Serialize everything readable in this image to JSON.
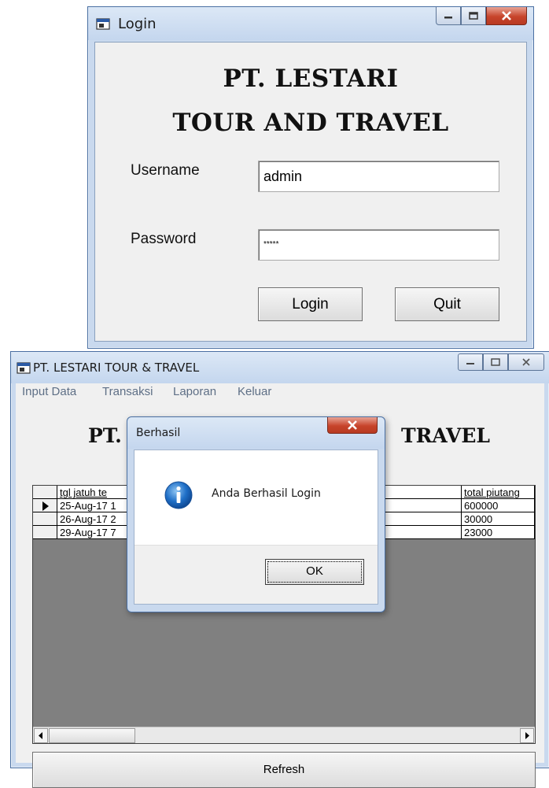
{
  "login_window": {
    "title": "Login",
    "company_line1": "PT. LESTARI",
    "company_line2": "TOUR AND TRAVEL",
    "username_label": "Username",
    "username_value": "admin",
    "password_label": "Password",
    "password_value": "*****",
    "login_button": "Login",
    "quit_button": "Quit"
  },
  "main_window": {
    "title": "PT. LESTARI TOUR & TRAVEL",
    "menu": [
      "Input Data",
      "Transaksi",
      "Laporan",
      "Keluar"
    ],
    "heading_left": "PT.",
    "heading_right": "TRAVEL",
    "grid": {
      "columns": [
        "tgl jatuh te",
        "total piutang"
      ],
      "rows": [
        {
          "col1": "25-Aug-17 1",
          "col_last": "600000"
        },
        {
          "col1": "26-Aug-17 2",
          "col_last": "30000"
        },
        {
          "col1": "29-Aug-17 7",
          "col_last": "23000"
        }
      ]
    },
    "refresh_button": "Refresh"
  },
  "message_box": {
    "title": "Berhasil",
    "message": "Anda Berhasil Login",
    "ok_button": "OK"
  },
  "colors": {
    "titlebar": "#c4d6ee",
    "close_button": "#c7442b",
    "info_icon": "#1f6fc7"
  }
}
